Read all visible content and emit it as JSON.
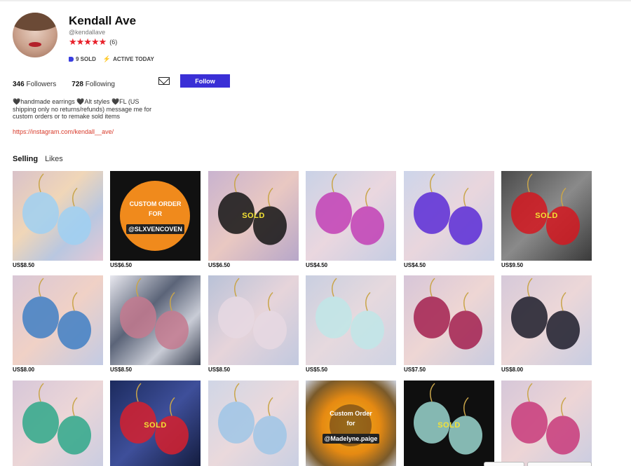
{
  "profile": {
    "name": "Kendall Ave",
    "handle": "@kendallave",
    "stars": "★★★★★",
    "rating_count": "(6)",
    "sold": "9 SOLD",
    "active": "ACTIVE TODAY",
    "followers_count": "346",
    "followers_label": "Followers",
    "following_count": "728",
    "following_label": "Following",
    "follow_button": "Follow",
    "bio": "🖤handmade earrings 🖤Alt styles 🖤FL (US shipping only no returns/refunds) message me for custom orders or to remake sold items",
    "link": "https://instagram.com/kendall__ave/"
  },
  "tabs": {
    "selling": "Selling",
    "likes": "Likes"
  },
  "items": [
    {
      "price": "US$8.50",
      "sold": "",
      "bg": "linear-gradient(135deg,#d9c2c9 0%,#f0d6b8 40%,#b9c7e0 70%,#e4c9d6 100%)",
      "accent": "#9fd0f2"
    },
    {
      "price": "US$6.50",
      "sold": "",
      "bg": "#111111",
      "accent": "#f08a1c",
      "text1": "CUSTOM ORDER",
      "text2": "FOR",
      "text3": "@SLXVENCOVEN"
    },
    {
      "price": "US$6.50",
      "sold": "SOLD",
      "bg": "linear-gradient(135deg,#c9b3cf 0%,#e9c8c2 50%,#b7a7c9 100%)",
      "accent": "#141414"
    },
    {
      "price": "US$4.50",
      "sold": "",
      "bg": "linear-gradient(135deg,#c9d2e6 0%,#ead7df 50%,#c6cde3 100%)",
      "accent": "#c23fb5"
    },
    {
      "price": "US$4.50",
      "sold": "",
      "bg": "linear-gradient(135deg,#cdd5ea 0%,#e9d6dd 50%,#c9cfe4 100%)",
      "accent": "#5a2bd6"
    },
    {
      "price": "US$9.50",
      "sold": "SOLD",
      "bg": "linear-gradient(135deg,#4a4a4a 0%,#8a8a8a 50%,#3a3a3a 100%)",
      "accent": "#d41820"
    },
    {
      "price": "US$8.00",
      "sold": "",
      "bg": "linear-gradient(135deg,#d9c7d6 0%,#f0d1c6 50%,#c3cbe4 100%)",
      "accent": "#3f7fc4"
    },
    {
      "price": "US$8.50",
      "sold": "",
      "bg": "linear-gradient(135deg,#e8e8ef 0%,#5b6478 40%,#c9ccd6 70%,#3a4152 100%)",
      "accent": "#c47a8f"
    },
    {
      "price": "US$8.50",
      "sold": "",
      "bg": "linear-gradient(135deg,#b9c2d8 0%,#e6d4da 50%,#c2c9df 100%)",
      "accent": "#e6d8e2"
    },
    {
      "price": "US$5.50",
      "sold": "",
      "bg": "linear-gradient(135deg,#c9cfe0 0%,#e6d9de 50%,#cfd3e3 100%)",
      "accent": "#bfe6e8"
    },
    {
      "price": "US$7.50",
      "sold": "",
      "bg": "linear-gradient(135deg,#d7c6d8 0%,#eed6d4 50%,#c9cce0 100%)",
      "accent": "#a3204f"
    },
    {
      "price": "US$8.00",
      "sold": "",
      "bg": "linear-gradient(135deg,#d6c9d9 0%,#ecd7d8 50%,#c8cde2 100%)",
      "accent": "#1c1c2a"
    },
    {
      "price": "",
      "sold": "",
      "bg": "linear-gradient(135deg,#d7c7d9 0%,#ecd6d7 50%,#c9cde2 100%)",
      "accent": "#2fa88a"
    },
    {
      "price": "",
      "sold": "SOLD",
      "bg": "linear-gradient(135deg,#1c2b5e 0%,#3e4f9a 50%,#121a3a 100%)",
      "accent": "#d6202e"
    },
    {
      "price": "",
      "sold": "",
      "bg": "linear-gradient(135deg,#d0d6e6 0%,#ead9dc 50%,#c8cfe3 100%)",
      "accent": "#9fc6e6"
    },
    {
      "price": "",
      "sold": "",
      "bg": "radial-gradient(circle at 50% 50%,#f2b21c 0%,#e68a12 45%,#7a5a2a 75%,#cfd4e0 100%)",
      "accent": "#333",
      "text1": "Custom Order",
      "text2": "for",
      "text3": "@Madelyne.paige"
    },
    {
      "price": "",
      "sold": "SOLD",
      "bg": "#0f0f0f",
      "accent": "#9ad6cf"
    },
    {
      "price": "",
      "sold": "",
      "bg": "linear-gradient(135deg,#d6c7d9 0%,#edd5d6 50%,#c9cde2 100%)",
      "accent": "#c83a7a"
    }
  ],
  "colors": {
    "accent": "#3a2fd6",
    "stars": "#e8202a",
    "link": "#d83a2a"
  }
}
